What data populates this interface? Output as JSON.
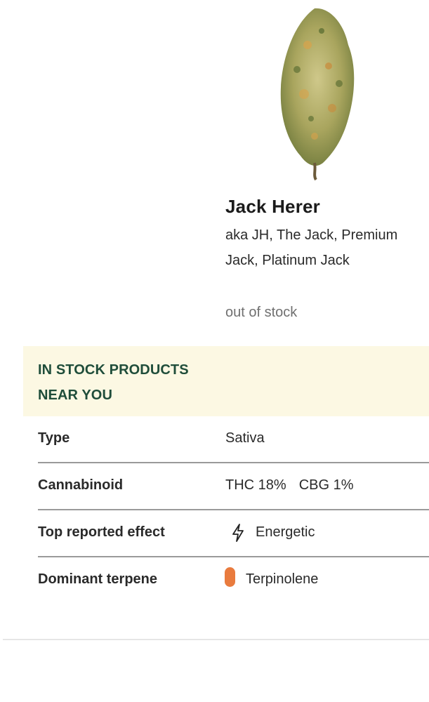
{
  "product": {
    "name": "Jack Herer",
    "aliases": "aka JH, The Jack, Premium Jack, Platinum Jack",
    "stock_status": "out of stock",
    "image_icon": "cannabis-bud-icon"
  },
  "banner": {
    "text": "IN STOCK PRODUCTS NEAR YOU",
    "background": "#fcf8e3",
    "text_color": "#1f4d3a"
  },
  "details": {
    "type": {
      "label": "Type",
      "value": "Sativa"
    },
    "cannabinoid": {
      "label": "Cannabinoid",
      "thc": "THC 18%",
      "cbg": "CBG 1%"
    },
    "effect": {
      "label": "Top reported effect",
      "value": "Energetic",
      "icon": "lightning-bolt-icon"
    },
    "terpene": {
      "label": "Dominant terpene",
      "value": "Terpinolene",
      "color": "#e97b3e"
    }
  }
}
